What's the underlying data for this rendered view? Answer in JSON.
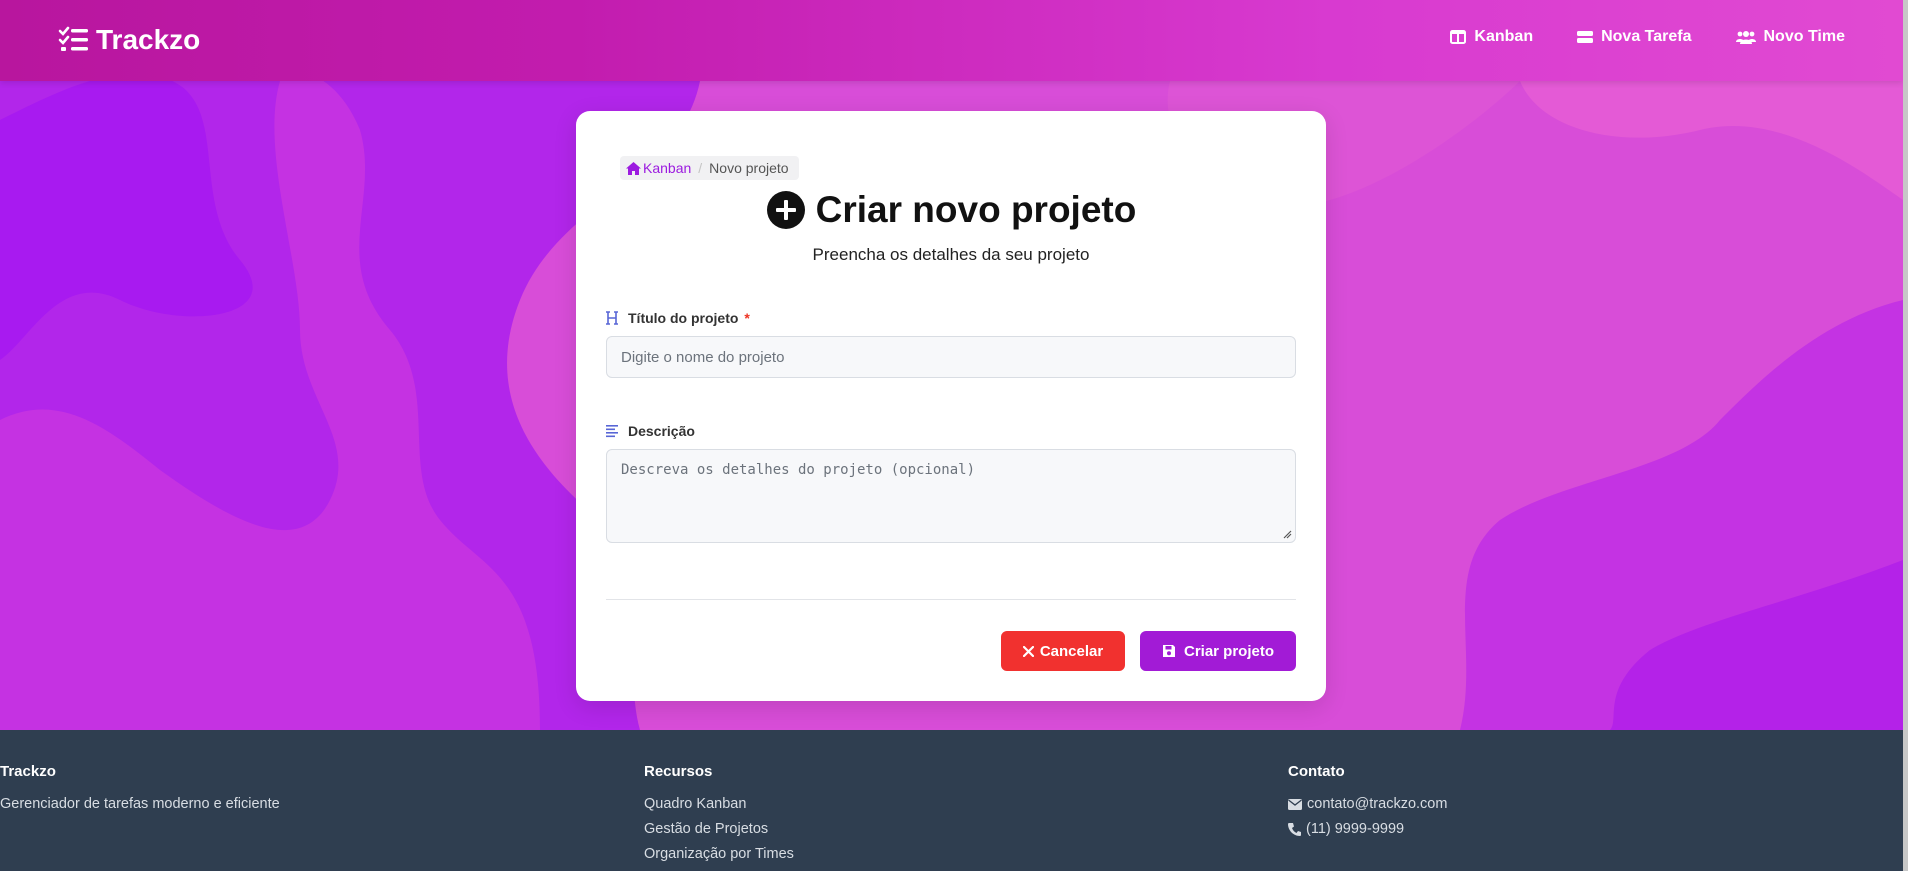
{
  "navbar": {
    "brand": "Trackzo",
    "links": [
      {
        "label": "Kanban",
        "icon": "columns-icon"
      },
      {
        "label": "Nova Tarefa",
        "icon": "tasks-icon"
      },
      {
        "label": "Novo Time",
        "icon": "users-icon"
      }
    ]
  },
  "breadcrumb": {
    "home": "Kanban",
    "current": "Novo projeto"
  },
  "form": {
    "title": "Criar novo projeto",
    "subtitle": "Preencha os detalhes da seu projeto",
    "title_label": "Título do projeto",
    "required_mark": "*",
    "title_placeholder": "Digite o nome do projeto",
    "description_label": "Descrição",
    "description_placeholder": "Descreva os detalhes do projeto (opcional)",
    "cancel_label": "Cancelar",
    "create_label": "Criar projeto"
  },
  "footer": {
    "col1": {
      "heading": "Trackzo",
      "text": "Gerenciador de tarefas moderno e eficiente"
    },
    "col2": {
      "heading": "Recursos",
      "items": [
        "Quadro Kanban",
        "Gestão de Projetos",
        "Organização por Times"
      ]
    },
    "col3": {
      "heading": "Contato",
      "email": "contato@trackzo.com",
      "phone": "(11) 9999-9999"
    }
  },
  "colors": {
    "accent": "#a21bd6",
    "danger": "#f1312f",
    "footer": "#2f3e50"
  }
}
